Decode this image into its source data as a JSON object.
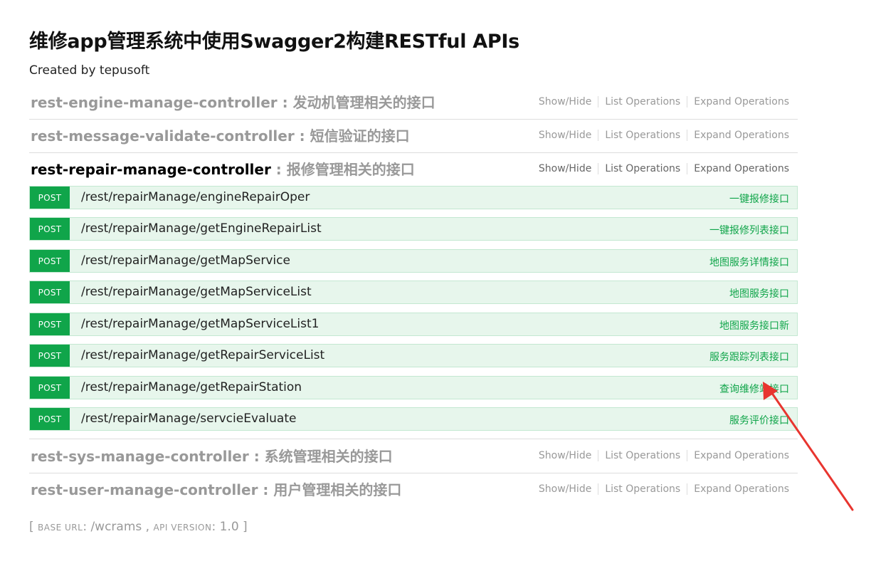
{
  "header": {
    "title": "维修app管理系统中使用Swagger2构建RESTful APIs",
    "subtitle": "Created by tepusoft"
  },
  "operations_labels": {
    "show_hide": "Show/Hide",
    "list": "List Operations",
    "expand": "Expand Operations"
  },
  "resources": [
    {
      "controller": "rest-engine-manage-controller",
      "description": " : 发动机管理相关的接口"
    },
    {
      "controller": "rest-message-validate-controller",
      "description": " : 短信验证的接口"
    },
    {
      "controller": "rest-repair-manage-controller",
      "description": " : 报修管理相关的接口"
    },
    {
      "controller": "rest-sys-manage-controller",
      "description": " : 系统管理相关的接口"
    },
    {
      "controller": "rest-user-manage-controller",
      "description": " : 用户管理相关的接口"
    }
  ],
  "endpoints": [
    {
      "method": "POST",
      "path": "/rest/repairManage/engineRepairOper",
      "summary": "一键报修接口"
    },
    {
      "method": "POST",
      "path": "/rest/repairManage/getEngineRepairList",
      "summary": "一键报修列表接口"
    },
    {
      "method": "POST",
      "path": "/rest/repairManage/getMapService",
      "summary": "地图服务详情接口"
    },
    {
      "method": "POST",
      "path": "/rest/repairManage/getMapServiceList",
      "summary": "地图服务接口"
    },
    {
      "method": "POST",
      "path": "/rest/repairManage/getMapServiceList1",
      "summary": "地图服务接口新"
    },
    {
      "method": "POST",
      "path": "/rest/repairManage/getRepairServiceList",
      "summary": "服务跟踪列表接口"
    },
    {
      "method": "POST",
      "path": "/rest/repairManage/getRepairStation",
      "summary": "查询维修站接口"
    },
    {
      "method": "POST",
      "path": "/rest/repairManage/servcieEvaluate",
      "summary": "服务评价接口"
    }
  ],
  "footer": {
    "open_bracket": "[ ",
    "base_url_label": "BASE URL",
    "base_url_value": ": /wcrams , ",
    "api_version_label": "API VERSION",
    "api_version_value": ": 1.0 ]"
  },
  "colors": {
    "post_method": "#10a54a",
    "endpoint_bg": "#e7f6ec",
    "annotation_arrow": "#e8352f"
  }
}
